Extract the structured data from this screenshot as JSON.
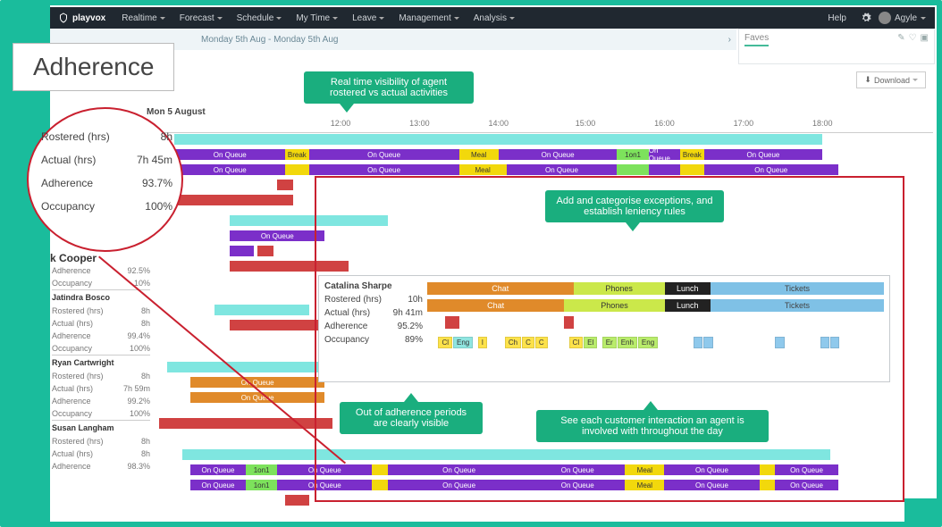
{
  "brand": "playvox",
  "nav": [
    "Realtime",
    "Forecast",
    "Schedule",
    "My Time",
    "Leave",
    "Management",
    "Analysis"
  ],
  "help": "Help",
  "user": "Agyle",
  "date_range": "Monday 5th Aug - Monday 5th Aug",
  "faves": "Faves",
  "download": "Download",
  "title": "Adherence",
  "metrics": {
    "rostered_hrs_label": "Rostered (hrs)",
    "rostered_hrs": "8h",
    "actual_hrs_label": "Actual (hrs)",
    "actual_hrs": "7h 45m",
    "adherence_label": "Adherence",
    "adherence": "93.7%",
    "occupancy_label": "Occupancy",
    "occupancy": "100%"
  },
  "agent_shown": "k Cooper",
  "day_header": "Mon 5 August",
  "ticks": [
    "12:00",
    "13:00",
    "14:00",
    "15:00",
    "16:00",
    "17:00",
    "18:00"
  ],
  "labels": {
    "onq": "On Queue",
    "break": "Break",
    "meal": "Meal",
    "oneon": "1on1",
    "chat": "Chat",
    "phones": "Phones",
    "lunch": "Lunch",
    "tickets": "Tickets"
  },
  "agents": [
    {
      "name": "Jatindra Bosco",
      "rows": [
        [
          "Rostered (hrs)",
          "8h"
        ],
        [
          "Actual (hrs)",
          "8h"
        ],
        [
          "Adherence",
          "99.4%"
        ],
        [
          "Occupancy",
          "100%"
        ]
      ]
    },
    {
      "name": "Ryan Cartwright",
      "rows": [
        [
          "Rostered (hrs)",
          "8h"
        ],
        [
          "Actual (hrs)",
          "7h 59m"
        ],
        [
          "Adherence",
          "99.2%"
        ],
        [
          "Occupancy",
          "100%"
        ]
      ]
    },
    {
      "name": "Susan Langham",
      "rows": [
        [
          "Rostered (hrs)",
          "8h"
        ],
        [
          "Actual (hrs)",
          "8h"
        ],
        [
          "Adherence",
          "98.3%"
        ]
      ]
    }
  ],
  "callouts": {
    "c1": "Real time visibility of agent rostered vs actual activities",
    "c2": "Add and categorise exceptions, and establish leniency rules",
    "c3": "Out of adherence periods are clearly visible",
    "c4": "See each customer interaction an agent is involved with throughout the day"
  },
  "detail": {
    "name": "Catalina Sharpe",
    "rows": [
      [
        "Rostered (hrs)",
        "10h"
      ],
      [
        "Actual (hrs)",
        "9h 41m"
      ],
      [
        "Adherence",
        "95.2%"
      ],
      [
        "Occupancy",
        "89%"
      ]
    ]
  },
  "substats": {
    "adherence_lbl": "Adherence",
    "adherence_val": "92.5%",
    "occ_lbl": "Occupancy",
    "occ_val": "10%"
  },
  "chips": [
    "Cl",
    "Eng",
    "I",
    "Ch",
    "C",
    "C",
    "Cl",
    "El",
    "Er",
    "Enh",
    "Eng"
  ]
}
